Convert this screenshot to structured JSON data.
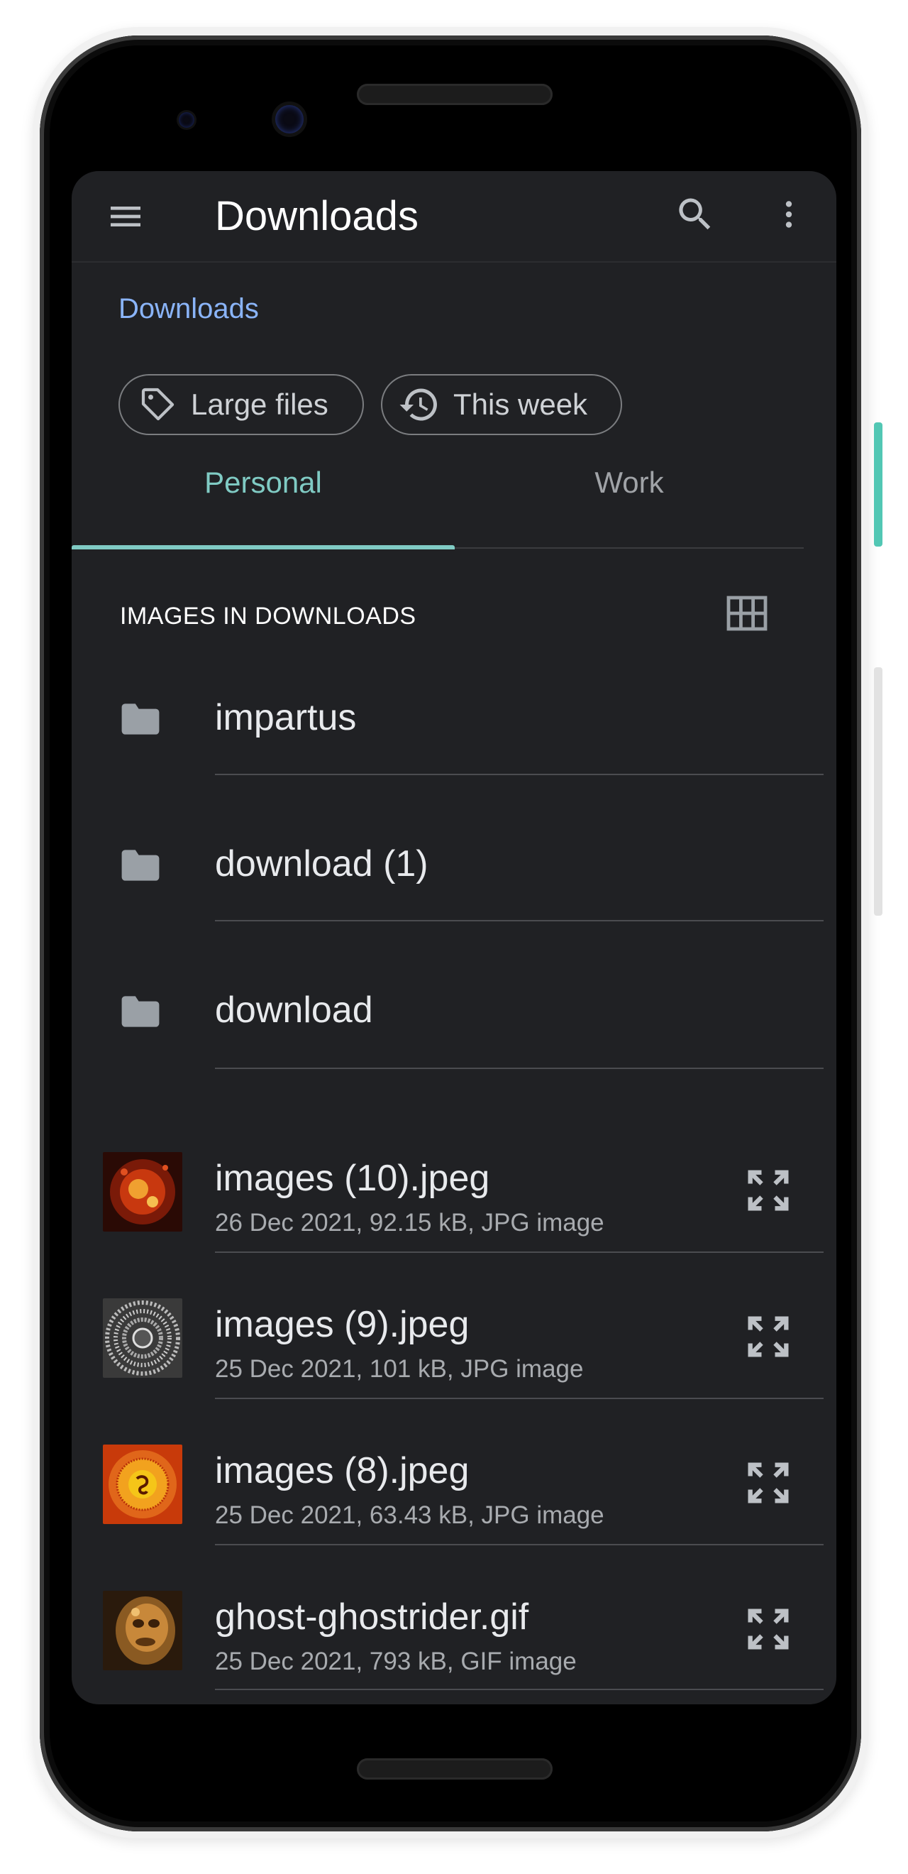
{
  "app_bar": {
    "title": "Downloads",
    "menu_icon": "menu-icon",
    "search_icon": "search-icon",
    "more_icon": "more-vert-icon"
  },
  "breadcrumb": "Downloads",
  "chips": [
    {
      "label": "Large files",
      "icon": "label-tag-icon"
    },
    {
      "label": "This week",
      "icon": "history-icon"
    }
  ],
  "tabs": [
    {
      "label": "Personal",
      "selected": true
    },
    {
      "label": "Work",
      "selected": false
    }
  ],
  "section": {
    "title": "IMAGES IN DOWNLOADS",
    "view_toggle_icon": "grid-view-icon"
  },
  "folders": [
    {
      "name": "impartus",
      "icon": "folder-icon"
    },
    {
      "name": "download (1)",
      "icon": "folder-icon"
    },
    {
      "name": "download",
      "icon": "folder-icon"
    }
  ],
  "files": [
    {
      "name": "images (10).jpeg",
      "meta": "26 Dec 2021, 92.15 kB, JPG image",
      "action_icon": "expand-icon"
    },
    {
      "name": "images (9).jpeg",
      "meta": "25 Dec 2021, 101 kB, JPG image",
      "action_icon": "expand-icon"
    },
    {
      "name": "images (8).jpeg",
      "meta": "25 Dec 2021, 63.43 kB, JPG image",
      "action_icon": "expand-icon"
    },
    {
      "name": "ghost-ghostrider.gif",
      "meta": "25 Dec 2021, 793 kB, GIF image",
      "action_icon": "expand-icon"
    }
  ],
  "colors": {
    "background": "#202124",
    "accent": "#80cbc4",
    "link": "#8ab4f8",
    "text_primary": "#e8eaed",
    "text_secondary": "#a8abaf"
  }
}
